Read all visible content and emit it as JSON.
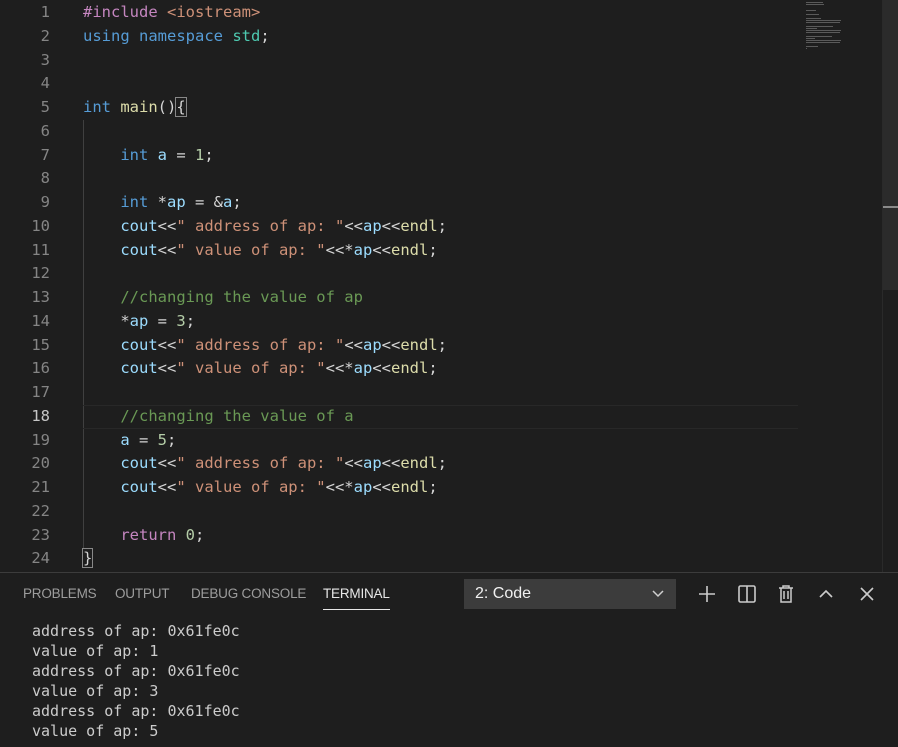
{
  "editor": {
    "active_line": 18,
    "lines": [
      {
        "n": "1",
        "tokens": [
          [
            "#include ",
            "pp"
          ],
          [
            "<iostream>",
            "inc"
          ]
        ]
      },
      {
        "n": "2",
        "tokens": [
          [
            "using ",
            "kw"
          ],
          [
            "namespace ",
            "kw"
          ],
          [
            "std",
            "ns"
          ],
          [
            ";",
            "op"
          ]
        ]
      },
      {
        "n": "3",
        "tokens": []
      },
      {
        "n": "4",
        "tokens": []
      },
      {
        "n": "5",
        "tokens": [
          [
            "int ",
            "ty"
          ],
          [
            "main",
            "fn"
          ],
          [
            "()",
            "br"
          ],
          [
            "{",
            "brm"
          ]
        ]
      },
      {
        "n": "6",
        "tokens": []
      },
      {
        "n": "7",
        "tokens": [
          [
            "    ",
            "op"
          ],
          [
            "int ",
            "ty"
          ],
          [
            "a",
            "var"
          ],
          [
            " = ",
            "op"
          ],
          [
            "1",
            "num"
          ],
          [
            ";",
            "op"
          ]
        ]
      },
      {
        "n": "8",
        "tokens": []
      },
      {
        "n": "9",
        "tokens": [
          [
            "    ",
            "op"
          ],
          [
            "int ",
            "ty"
          ],
          [
            "*",
            "op"
          ],
          [
            "ap",
            "var"
          ],
          [
            " = ",
            "op"
          ],
          [
            "&",
            "op"
          ],
          [
            "a",
            "var"
          ],
          [
            ";",
            "op"
          ]
        ]
      },
      {
        "n": "10",
        "tokens": [
          [
            "    ",
            "op"
          ],
          [
            "cout",
            "var"
          ],
          [
            "<<",
            "op"
          ],
          [
            "\" address of ap: \"",
            "str"
          ],
          [
            "<<",
            "op"
          ],
          [
            "ap",
            "var"
          ],
          [
            "<<",
            "op"
          ],
          [
            "endl",
            "fn"
          ],
          [
            ";",
            "op"
          ]
        ]
      },
      {
        "n": "11",
        "tokens": [
          [
            "    ",
            "op"
          ],
          [
            "cout",
            "var"
          ],
          [
            "<<",
            "op"
          ],
          [
            "\" value of ap: \"",
            "str"
          ],
          [
            "<<*",
            "op"
          ],
          [
            "ap",
            "var"
          ],
          [
            "<<",
            "op"
          ],
          [
            "endl",
            "fn"
          ],
          [
            ";",
            "op"
          ]
        ]
      },
      {
        "n": "12",
        "tokens": []
      },
      {
        "n": "13",
        "tokens": [
          [
            "    ",
            "op"
          ],
          [
            "//changing the value of ap",
            "cm"
          ]
        ]
      },
      {
        "n": "14",
        "tokens": [
          [
            "    ",
            "op"
          ],
          [
            "*",
            "op"
          ],
          [
            "ap",
            "var"
          ],
          [
            " = ",
            "op"
          ],
          [
            "3",
            "num"
          ],
          [
            ";",
            "op"
          ]
        ]
      },
      {
        "n": "15",
        "tokens": [
          [
            "    ",
            "op"
          ],
          [
            "cout",
            "var"
          ],
          [
            "<<",
            "op"
          ],
          [
            "\" address of ap: \"",
            "str"
          ],
          [
            "<<",
            "op"
          ],
          [
            "ap",
            "var"
          ],
          [
            "<<",
            "op"
          ],
          [
            "endl",
            "fn"
          ],
          [
            ";",
            "op"
          ]
        ]
      },
      {
        "n": "16",
        "tokens": [
          [
            "    ",
            "op"
          ],
          [
            "cout",
            "var"
          ],
          [
            "<<",
            "op"
          ],
          [
            "\" value of ap: \"",
            "str"
          ],
          [
            "<<*",
            "op"
          ],
          [
            "ap",
            "var"
          ],
          [
            "<<",
            "op"
          ],
          [
            "endl",
            "fn"
          ],
          [
            ";",
            "op"
          ]
        ]
      },
      {
        "n": "17",
        "tokens": []
      },
      {
        "n": "18",
        "tokens": [
          [
            "    ",
            "op"
          ],
          [
            "//changing the value of a",
            "cm"
          ]
        ]
      },
      {
        "n": "19",
        "tokens": [
          [
            "    ",
            "op"
          ],
          [
            "a",
            "var"
          ],
          [
            " = ",
            "op"
          ],
          [
            "5",
            "num"
          ],
          [
            ";",
            "op"
          ]
        ]
      },
      {
        "n": "20",
        "tokens": [
          [
            "    ",
            "op"
          ],
          [
            "cout",
            "var"
          ],
          [
            "<<",
            "op"
          ],
          [
            "\" address of ap: \"",
            "str"
          ],
          [
            "<<",
            "op"
          ],
          [
            "ap",
            "var"
          ],
          [
            "<<",
            "op"
          ],
          [
            "endl",
            "fn"
          ],
          [
            ";",
            "op"
          ]
        ]
      },
      {
        "n": "21",
        "tokens": [
          [
            "    ",
            "op"
          ],
          [
            "cout",
            "var"
          ],
          [
            "<<",
            "op"
          ],
          [
            "\" value of ap: \"",
            "str"
          ],
          [
            "<<*",
            "op"
          ],
          [
            "ap",
            "var"
          ],
          [
            "<<",
            "op"
          ],
          [
            "endl",
            "fn"
          ],
          [
            ";",
            "op"
          ]
        ]
      },
      {
        "n": "22",
        "tokens": []
      },
      {
        "n": "23",
        "tokens": [
          [
            "    ",
            "op"
          ],
          [
            "return ",
            "ctl"
          ],
          [
            "0",
            "num"
          ],
          [
            ";",
            "op"
          ]
        ]
      },
      {
        "n": "24",
        "tokens": [
          [
            "}",
            "brm"
          ]
        ]
      }
    ]
  },
  "panel": {
    "tabs": {
      "problems": "PROBLEMS",
      "output": "OUTPUT",
      "debug_console": "DEBUG CONSOLE",
      "terminal": "TERMINAL"
    },
    "terminal_select": "2: Code",
    "icons": {
      "add": "plus-icon",
      "split": "split-icon",
      "kill": "trash-icon",
      "maximize": "chevron-up-icon",
      "close": "close-icon"
    },
    "terminal_output": [
      "address of ap: 0x61fe0c",
      "value of ap: 1",
      "address of ap: 0x61fe0c",
      "value of ap: 3",
      "address of ap: 0x61fe0c",
      "value of ap: 5"
    ]
  },
  "colors": {
    "background": "#1e1e1e",
    "panel_border": "#3c3c3c",
    "select_bg": "#3c3c3c"
  }
}
